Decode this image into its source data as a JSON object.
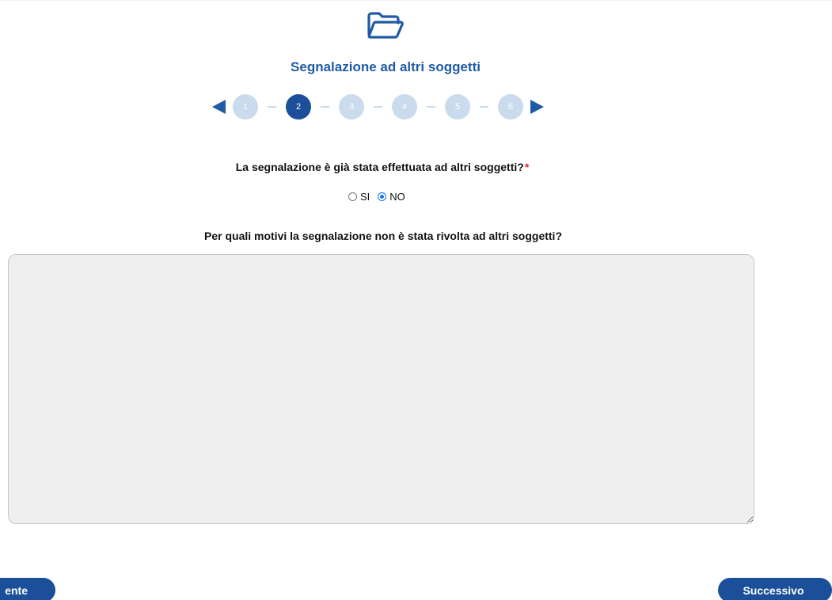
{
  "section": {
    "icon": "folder-open-icon",
    "title": "Segnalazione ad altri soggetti"
  },
  "stepper": {
    "steps": [
      "1",
      "2",
      "3",
      "4",
      "5",
      "6"
    ],
    "current": "2",
    "accent_color": "#1b4f9a",
    "inactive_color": "#c9dbec"
  },
  "question1": {
    "text": "La segnalazione è già stata effettuata ad altri soggetti?",
    "required_mark": "*",
    "options": [
      "SI",
      "NO"
    ],
    "selected": "NO"
  },
  "question2": {
    "text": "Per quali motivi la segnalazione non è stata rivolta ad altri soggetti?",
    "value": ""
  },
  "navigation": {
    "prev_label": "ente",
    "next_label": "Successivo"
  }
}
